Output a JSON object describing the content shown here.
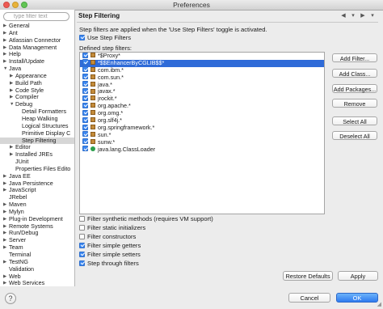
{
  "window": {
    "title": "Preferences"
  },
  "sidebar": {
    "filter_placeholder": "type filter text",
    "items": [
      {
        "label": "General",
        "depth": 0,
        "expand": "collapsed"
      },
      {
        "label": "Ant",
        "depth": 0,
        "expand": "collapsed"
      },
      {
        "label": "Atlassian Connector",
        "depth": 0,
        "expand": "collapsed"
      },
      {
        "label": "Data Management",
        "depth": 0,
        "expand": "collapsed"
      },
      {
        "label": "Help",
        "depth": 0,
        "expand": "collapsed"
      },
      {
        "label": "Install/Update",
        "depth": 0,
        "expand": "collapsed"
      },
      {
        "label": "Java",
        "depth": 0,
        "expand": "expanded"
      },
      {
        "label": "Appearance",
        "depth": 1,
        "expand": "collapsed"
      },
      {
        "label": "Build Path",
        "depth": 1,
        "expand": "collapsed"
      },
      {
        "label": "Code Style",
        "depth": 1,
        "expand": "collapsed"
      },
      {
        "label": "Compiler",
        "depth": 1,
        "expand": "collapsed"
      },
      {
        "label": "Debug",
        "depth": 1,
        "expand": "expanded"
      },
      {
        "label": "Detail Formatters",
        "depth": 2,
        "expand": "none"
      },
      {
        "label": "Heap Walking",
        "depth": 2,
        "expand": "none"
      },
      {
        "label": "Logical Structures",
        "depth": 2,
        "expand": "none"
      },
      {
        "label": "Primitive Display C",
        "depth": 2,
        "expand": "none"
      },
      {
        "label": "Step Filtering",
        "depth": 2,
        "expand": "none",
        "selected": true
      },
      {
        "label": "Editor",
        "depth": 1,
        "expand": "collapsed"
      },
      {
        "label": "Installed JREs",
        "depth": 1,
        "expand": "collapsed"
      },
      {
        "label": "JUnit",
        "depth": 1,
        "expand": "none"
      },
      {
        "label": "Properties Files Edito",
        "depth": 1,
        "expand": "none"
      },
      {
        "label": "Java EE",
        "depth": 0,
        "expand": "collapsed"
      },
      {
        "label": "Java Persistence",
        "depth": 0,
        "expand": "collapsed"
      },
      {
        "label": "JavaScript",
        "depth": 0,
        "expand": "collapsed"
      },
      {
        "label": "JRebel",
        "depth": 0,
        "expand": "none"
      },
      {
        "label": "Maven",
        "depth": 0,
        "expand": "collapsed"
      },
      {
        "label": "Mylyn",
        "depth": 0,
        "expand": "collapsed"
      },
      {
        "label": "Plug-in Development",
        "depth": 0,
        "expand": "collapsed"
      },
      {
        "label": "Remote Systems",
        "depth": 0,
        "expand": "collapsed"
      },
      {
        "label": "Run/Debug",
        "depth": 0,
        "expand": "collapsed"
      },
      {
        "label": "Server",
        "depth": 0,
        "expand": "collapsed"
      },
      {
        "label": "Team",
        "depth": 0,
        "expand": "collapsed"
      },
      {
        "label": "Terminal",
        "depth": 0,
        "expand": "none"
      },
      {
        "label": "TestNG",
        "depth": 0,
        "expand": "collapsed"
      },
      {
        "label": "Validation",
        "depth": 0,
        "expand": "none"
      },
      {
        "label": "Web",
        "depth": 0,
        "expand": "collapsed"
      },
      {
        "label": "Web Services",
        "depth": 0,
        "expand": "collapsed"
      }
    ]
  },
  "page": {
    "title": "Step Filtering",
    "description": "Step filters are applied when the 'Use Step Filters' toggle is activated.",
    "use_step_filters": {
      "label": "Use Step Filters",
      "checked": true
    },
    "defined_label": "Defined step filters:",
    "filters": [
      {
        "label": "*$Proxy*",
        "checked": true,
        "icon": "package"
      },
      {
        "label": "*$$EnhancerByCGLIB$$*",
        "checked": true,
        "icon": "package",
        "selected": true
      },
      {
        "label": "com.ibm.*",
        "checked": true,
        "icon": "package"
      },
      {
        "label": "com.sun.*",
        "checked": true,
        "icon": "package"
      },
      {
        "label": "java.*",
        "checked": true,
        "icon": "package"
      },
      {
        "label": "javax.*",
        "checked": true,
        "icon": "package"
      },
      {
        "label": "jrockit.*",
        "checked": true,
        "icon": "package"
      },
      {
        "label": "org.apache.*",
        "checked": true,
        "icon": "package"
      },
      {
        "label": "org.omg.*",
        "checked": true,
        "icon": "package"
      },
      {
        "label": "org.slf4j.*",
        "checked": true,
        "icon": "package"
      },
      {
        "label": "org.springframework.*",
        "checked": true,
        "icon": "package"
      },
      {
        "label": "sun.*",
        "checked": true,
        "icon": "package"
      },
      {
        "label": "sunw.*",
        "checked": true,
        "icon": "package"
      },
      {
        "label": "java.lang.ClassLoader",
        "checked": true,
        "icon": "class"
      }
    ],
    "side_buttons": [
      "Add Filter...",
      "Add Class...",
      "Add Packages...",
      "Remove",
      "Select All",
      "Deselect All"
    ],
    "options": [
      {
        "label": "Filter synthetic methods (requires VM support)",
        "checked": false
      },
      {
        "label": "Filter static initializers",
        "checked": false
      },
      {
        "label": "Filter constructors",
        "checked": false
      },
      {
        "label": "Filter simple getters",
        "checked": true
      },
      {
        "label": "Filter simple setters",
        "checked": true
      },
      {
        "label": "Step through filters",
        "checked": true
      }
    ],
    "restore_defaults": "Restore Defaults",
    "apply": "Apply"
  },
  "footer": {
    "cancel": "Cancel",
    "ok": "OK",
    "help_glyph": "?"
  },
  "colors": {
    "selection": "#2f6bd8",
    "checkbox": "#3a86f0"
  }
}
